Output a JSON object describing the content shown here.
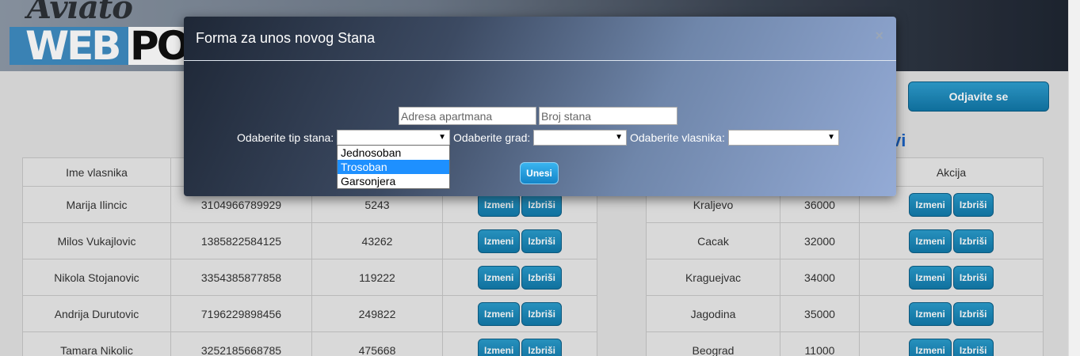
{
  "header": {
    "logo_script": "Aviato",
    "logo_web": "WEB",
    "logo_po": "PO"
  },
  "page": {
    "logout_label": "Odjavite se",
    "section_title_fragment": "vi"
  },
  "owners_table": {
    "columns": [
      "Ime vlasnika",
      "",
      "",
      ""
    ],
    "rows": [
      {
        "name": "Marija Ilincic",
        "jmbg": "3104966789929",
        "number": "5243"
      },
      {
        "name": "Milos Vukajlovic",
        "jmbg": "1385822584125",
        "number": "43262"
      },
      {
        "name": "Nikola Stojanovic",
        "jmbg": "3354385877858",
        "number": "119222"
      },
      {
        "name": "Andrija Durutovic",
        "jmbg": "7196229898456",
        "number": "249822"
      },
      {
        "name": "Tamara Nikolic",
        "jmbg": "3252185668785",
        "number": "475668"
      }
    ],
    "edit_label": "Izmeni",
    "delete_label": "Izbriši"
  },
  "cities_table": {
    "columns": [
      "",
      "",
      "Akcija"
    ],
    "rows": [
      {
        "city": "Kraljevo",
        "zip": "36000"
      },
      {
        "city": "Cacak",
        "zip": "32000"
      },
      {
        "city": "Kraguejvac",
        "zip": "34000"
      },
      {
        "city": "Jagodina",
        "zip": "35000"
      },
      {
        "city": "Beograd",
        "zip": "11000"
      }
    ],
    "edit_label": "Izmeni",
    "delete_label": "Izbriši"
  },
  "modal": {
    "title": "Forma za unos novog Stana",
    "close_glyph": "×",
    "address_placeholder": "Adresa apartmana",
    "number_placeholder": "Broj stana",
    "type_label": "Odaberite tip stana:",
    "city_label": "Odaberite grad:",
    "owner_label": "Odaberite vlasnika:",
    "type_value": "",
    "city_value": "",
    "owner_value": "",
    "type_options": [
      "Jednosoban",
      "Trosoban",
      "Garsonjera"
    ],
    "type_highlighted": "Trosoban",
    "submit_label": "Unesi"
  }
}
